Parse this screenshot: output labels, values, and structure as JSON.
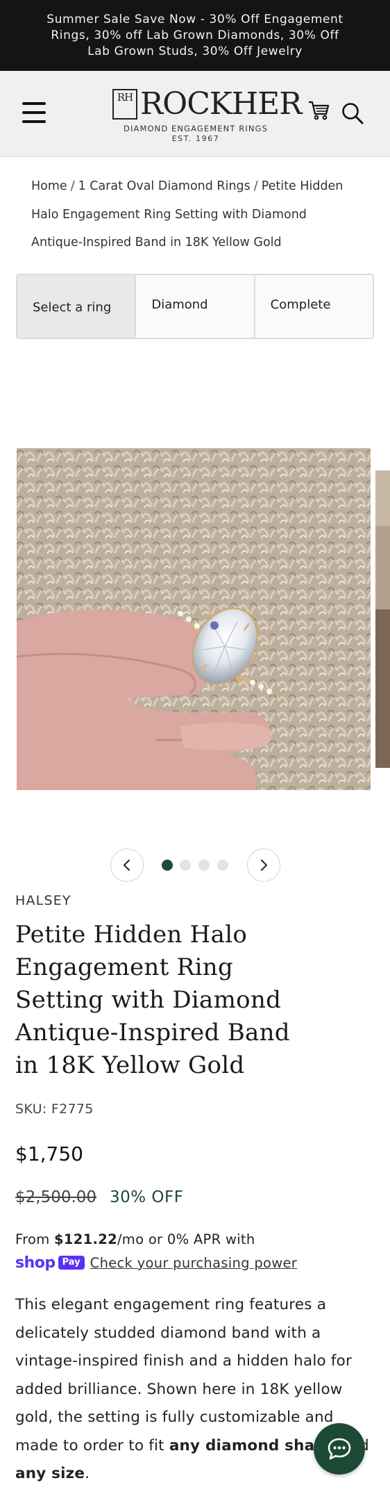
{
  "announcement": {
    "text": "Summer Sale Save Now - 30% Off Engagement Rings, 30% off Lab Grown Diamonds, 30% Off Lab Grown Studs, 30% Off Jewelry"
  },
  "header": {
    "logo_mark": "RH",
    "logo_word": "ROCKHER",
    "logo_tagline": "DIAMOND ENGAGEMENT RINGS",
    "logo_est": "EST. 1967",
    "icons": [
      "menu-icon",
      "cart-icon",
      "search-icon"
    ]
  },
  "breadcrumb": {
    "items": [
      "Home",
      "1 Carat Oval Diamond Rings",
      "Petite Hidden Halo Engagement Ring Setting with Diamond Antique-Inspired Band in 18K Yellow Gold"
    ],
    "separator": "/"
  },
  "steps": [
    {
      "label": "Select a ring",
      "active": true
    },
    {
      "label": "Diamond",
      "active": false
    },
    {
      "label": "Complete",
      "active": false
    }
  ],
  "gallery": {
    "slide_count": 4,
    "active_index": 0,
    "icons": [
      "chevron-left-icon",
      "chevron-right-icon"
    ]
  },
  "product": {
    "brand": "HALSEY",
    "title": "Petite Hidden Halo Engagement Ring Setting with Diamond Antique-Inspired Band in 18K Yellow Gold",
    "sku": "SKU: F2775",
    "price": "$1,750",
    "compare_price": "$2,500.00",
    "discount": "30% OFF",
    "financing": {
      "prefix": "From ",
      "amount": "$121.22",
      "suffix": "/mo or 0% APR with",
      "shop_word": "shop",
      "pay_word": "Pay",
      "link": "Check your purchasing power"
    },
    "description": {
      "text": "This elegant engagement ring features a delicately studded diamond band with a vintage-inspired finish and a hidden halo for added brilliance. Shown here in 18K yellow gold, the setting is fully customizable and made to order to fit ",
      "bold1": "any diamond shape",
      "mid": " and ",
      "bold2": "any size",
      "end": "."
    }
  },
  "colors": {
    "announcement_bg": "#141414",
    "header_bg": "#f0f0f0",
    "accent_green": "#1d4a36",
    "shop_pay_purple": "#5a31f4"
  },
  "chat": {
    "icon": "chat-bubble-icon"
  }
}
